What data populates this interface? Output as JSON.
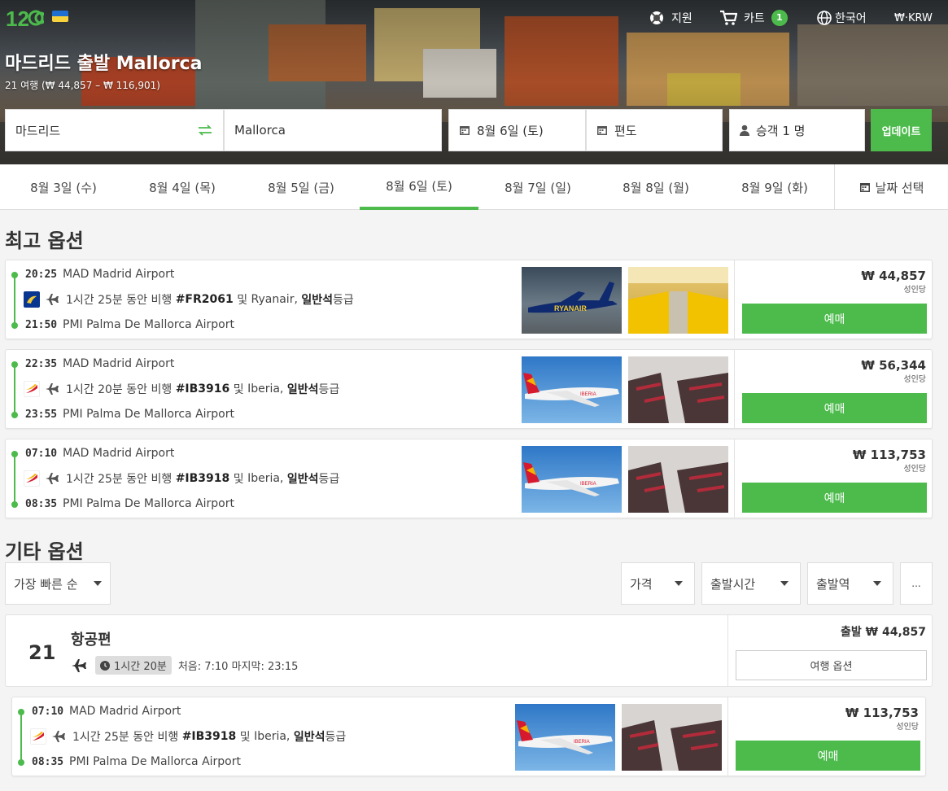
{
  "header": {
    "logo_text": "12GO",
    "support": "지원",
    "cart": "카트",
    "cart_count": "1",
    "language": "한국어",
    "currency": "₩·KRW",
    "title": "마드리드 출발 Mallorca",
    "subtitle": "21 여행 (₩ 44,857 – ₩ 116,901)"
  },
  "search": {
    "from": "마드리드",
    "to": "Mallorca",
    "date": "8월 6일 (토)",
    "trip_type": "편도",
    "passengers": "승객 1 명",
    "update_label": "업데이트"
  },
  "date_tabs": {
    "items": [
      "8월 3일 (수)",
      "8월 4일 (목)",
      "8월 5일 (금)",
      "8월 6일 (토)",
      "8월 7일 (일)",
      "8월 8일 (월)",
      "8월 9일 (화)"
    ],
    "active_index": 3,
    "pick_label": "날짜 선택"
  },
  "best_options": {
    "heading": "최고 옵션",
    "flights": [
      {
        "dep_time": "20:25",
        "dep_airport": "MAD Madrid Airport",
        "duration_text": "1시간 25분 동안 비행",
        "flight_no": "#FR2061",
        "and": "및",
        "airline": "Ryanair,",
        "cabin": "일반석",
        "cabin_suffix": "등급",
        "arr_time": "21:50",
        "arr_airport": "PMI Palma De Mallorca Airport",
        "price": "₩ 44,857",
        "per_person": "성인당",
        "book_label": "예매",
        "airline_icon": "ryanair-logo"
      },
      {
        "dep_time": "22:35",
        "dep_airport": "MAD Madrid Airport",
        "duration_text": "1시간 20분 동안 비행",
        "flight_no": "#IB3916",
        "and": "및",
        "airline": "Iberia,",
        "cabin": "일반석",
        "cabin_suffix": "등급",
        "arr_time": "23:55",
        "arr_airport": "PMI Palma De Mallorca Airport",
        "price": "₩ 56,344",
        "per_person": "성인당",
        "book_label": "예매",
        "airline_icon": "iberia-logo"
      },
      {
        "dep_time": "07:10",
        "dep_airport": "MAD Madrid Airport",
        "duration_text": "1시간 25분 동안 비행",
        "flight_no": "#IB3918",
        "and": "및",
        "airline": "Iberia,",
        "cabin": "일반석",
        "cabin_suffix": "등급",
        "arr_time": "08:35",
        "arr_airport": "PMI Palma De Mallorca Airport",
        "price": "₩ 113,753",
        "per_person": "성인당",
        "book_label": "예매",
        "airline_icon": "iberia-logo"
      }
    ]
  },
  "other_options": {
    "heading": "기타 옵션",
    "sort": "가장 빠른 순",
    "filters": {
      "price": "가격",
      "departure_time": "출발시간",
      "departure_station": "출발역",
      "more": "..."
    },
    "group": {
      "count": "21",
      "title": "항공편",
      "duration": "1시간 20분",
      "first_last": "처음: 7:10 마지막: 23:15",
      "price": "출발 ₩ 44,857",
      "options_label": "여행 옵션"
    },
    "flight": {
      "dep_time": "07:10",
      "dep_airport": "MAD Madrid Airport",
      "duration_text": "1시간 25분 동안 비행",
      "flight_no": "#IB3918",
      "and": "및",
      "airline": "Iberia,",
      "cabin": "일반석",
      "cabin_suffix": "등급",
      "arr_time": "08:35",
      "arr_airport": "PMI Palma De Mallorca Airport",
      "price": "₩ 113,753",
      "per_person": "성인당",
      "book_label": "예매",
      "airline_icon": "iberia-logo"
    }
  },
  "colors": {
    "accent": "#4cbb4c",
    "ryanair": "#073590",
    "iberia_red": "#d7192d",
    "iberia_yellow": "#f9b000"
  }
}
